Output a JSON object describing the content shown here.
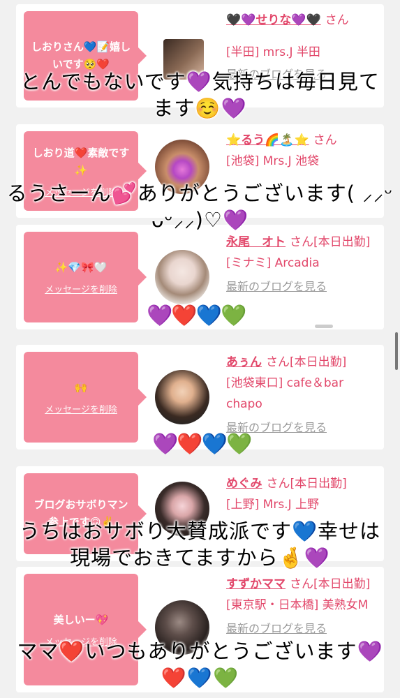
{
  "messages": [
    {
      "bubble": "しおりさん💙📝嬉しいです🥺❤️",
      "delete_label": "",
      "name": "🖤💜せりな💜🖤",
      "san": "さん",
      "shop": "[半田] mrs.J 半田",
      "blog": "最新のブログを見る",
      "overlay": [
        "とんでもないです💜気持ちは毎日見て",
        "ます☺️💜"
      ],
      "hearts": ""
    },
    {
      "bubble": "しおり道❤️素敵です✨",
      "delete_label": "メッセージを削除",
      "name": "⭐るう🌈🏝️⭐",
      "san": "さん",
      "shop": "[池袋] Mrs.J 池袋",
      "blog": "最新のブログを見る",
      "overlay": [
        "るうさーん💕ありがとうございます( ⸝⸝ᵕ",
        "ᴗᵕ⸝⸝)♡💜"
      ],
      "hearts": ""
    },
    {
      "bubble": "✨💎🎀🤍",
      "delete_label": "メッセージを削除",
      "name": "永尾　オト",
      "san": "さん[本日出勤]",
      "shop": "[ミナミ] Arcadia",
      "blog": "最新のブログを見る",
      "overlay": [],
      "hearts": "💜❤️💙💚"
    },
    {
      "bubble": "🙌",
      "delete_label": "メッセージを削除",
      "name": "あぅん",
      "san": "さん[本日出勤]",
      "shop": "[池袋東口] cafe＆bar chapo",
      "blog": "最新のブログを見る",
      "overlay": [],
      "hearts": "💜❤️💙💚"
    },
    {
      "bubble": "ブログおサボりマン参上です🙃✌️",
      "delete_label": "",
      "name": "めぐみ",
      "san": "さん[本日出勤]",
      "shop": "[上野] Mrs.J 上野",
      "blog": "最新のブログを見る",
      "overlay": [
        "うちはおサボり大賛成派です💙幸せは",
        "現場でおきてますから🤞💜"
      ],
      "hearts": ""
    },
    {
      "bubble": "美しいー💖",
      "delete_label": "メッセージを削除",
      "name": "すずかママ",
      "san": "さん[本日出勤]",
      "shop": "[東京駅・日本橋] 美熟女M",
      "blog": "最新のブログを見る",
      "overlay": [
        "ママ❤️いつもありがとうございます💜",
        "❤️💙💚"
      ],
      "hearts": ""
    }
  ],
  "colors": {
    "accent": "#f48a9d",
    "name_text": "#e2476a",
    "link_gray": "#999999"
  }
}
